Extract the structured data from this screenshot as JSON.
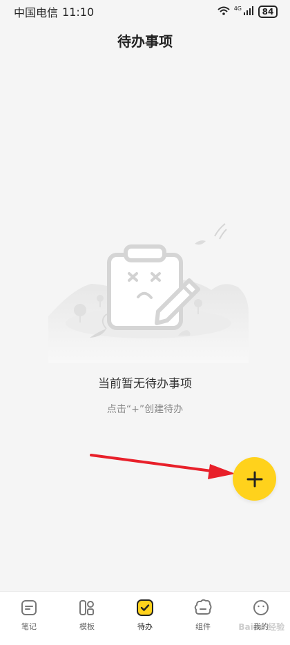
{
  "status": {
    "carrier": "中国电信",
    "time": "11:10",
    "network": "4G",
    "battery": "84"
  },
  "header": {
    "title": "待办事项"
  },
  "empty_state": {
    "title": "当前暂无待办事项",
    "hint": "点击“+”创建待办"
  },
  "fab": {
    "icon": "plus-icon"
  },
  "tabs": [
    {
      "label": "笔记",
      "icon": "note-icon",
      "active": false
    },
    {
      "label": "模板",
      "icon": "template-icon",
      "active": false
    },
    {
      "label": "待办",
      "icon": "check-icon",
      "active": true
    },
    {
      "label": "组件",
      "icon": "widget-icon",
      "active": false
    },
    {
      "label": "我的",
      "icon": "profile-icon",
      "active": false
    }
  ],
  "watermark": "Baidu 经验",
  "colors": {
    "accent": "#ffd21c",
    "background": "#f5f5f5",
    "arrow": "#e8202a"
  }
}
